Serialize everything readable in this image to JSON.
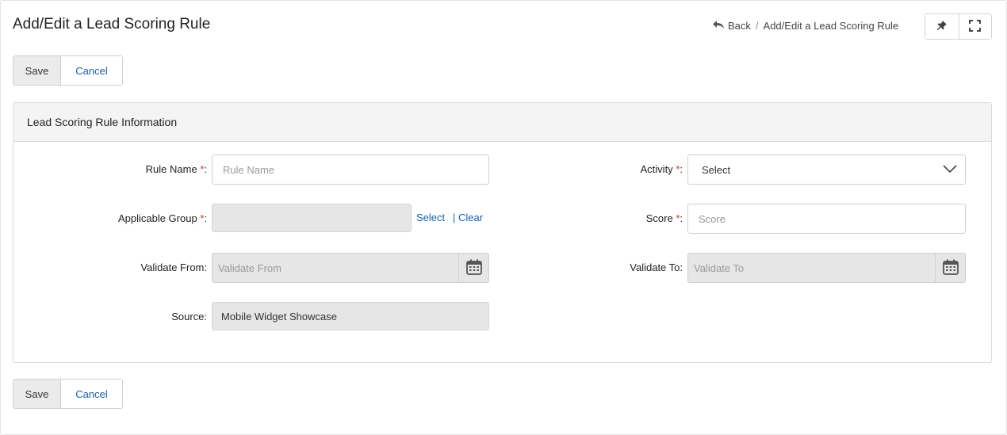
{
  "page": {
    "title": "Add/Edit a Lead Scoring Rule"
  },
  "breadcrumb": {
    "back_label": "Back",
    "separator": "/",
    "current": "Add/Edit a Lead Scoring Rule"
  },
  "toolbar": {
    "save_label": "Save",
    "cancel_label": "Cancel"
  },
  "panel": {
    "title": "Lead Scoring Rule Information"
  },
  "form": {
    "rule_name": {
      "label": "Rule Name",
      "required": "*",
      "colon": ":",
      "placeholder": "Rule Name"
    },
    "applicable_group": {
      "label": "Applicable Group",
      "required": "*",
      "colon": ":",
      "select_link": "Select",
      "separator": "|",
      "clear_link": "Clear"
    },
    "validate_from": {
      "label": "Validate From:",
      "placeholder": "Validate From"
    },
    "source": {
      "label": "Source:",
      "value": "Mobile Widget Showcase"
    },
    "activity": {
      "label": "Activity",
      "required": "*",
      "colon": ":",
      "selected": "Select"
    },
    "score": {
      "label": "Score",
      "required": "*",
      "colon": ":",
      "placeholder": "Score"
    },
    "validate_to": {
      "label": "Validate To:",
      "placeholder": "Validate To"
    }
  },
  "icons": {
    "back": "back-arrow-icon",
    "pin": "pin-icon",
    "fullscreen": "fullscreen-icon",
    "calendar": "calendar-icon",
    "chevron": "chevron-down-icon"
  },
  "colors": {
    "link": "#1a5fa8",
    "required": "#c0392b",
    "panel_header_bg": "#f4f4f4",
    "disabled_bg": "#e6e6e6"
  }
}
